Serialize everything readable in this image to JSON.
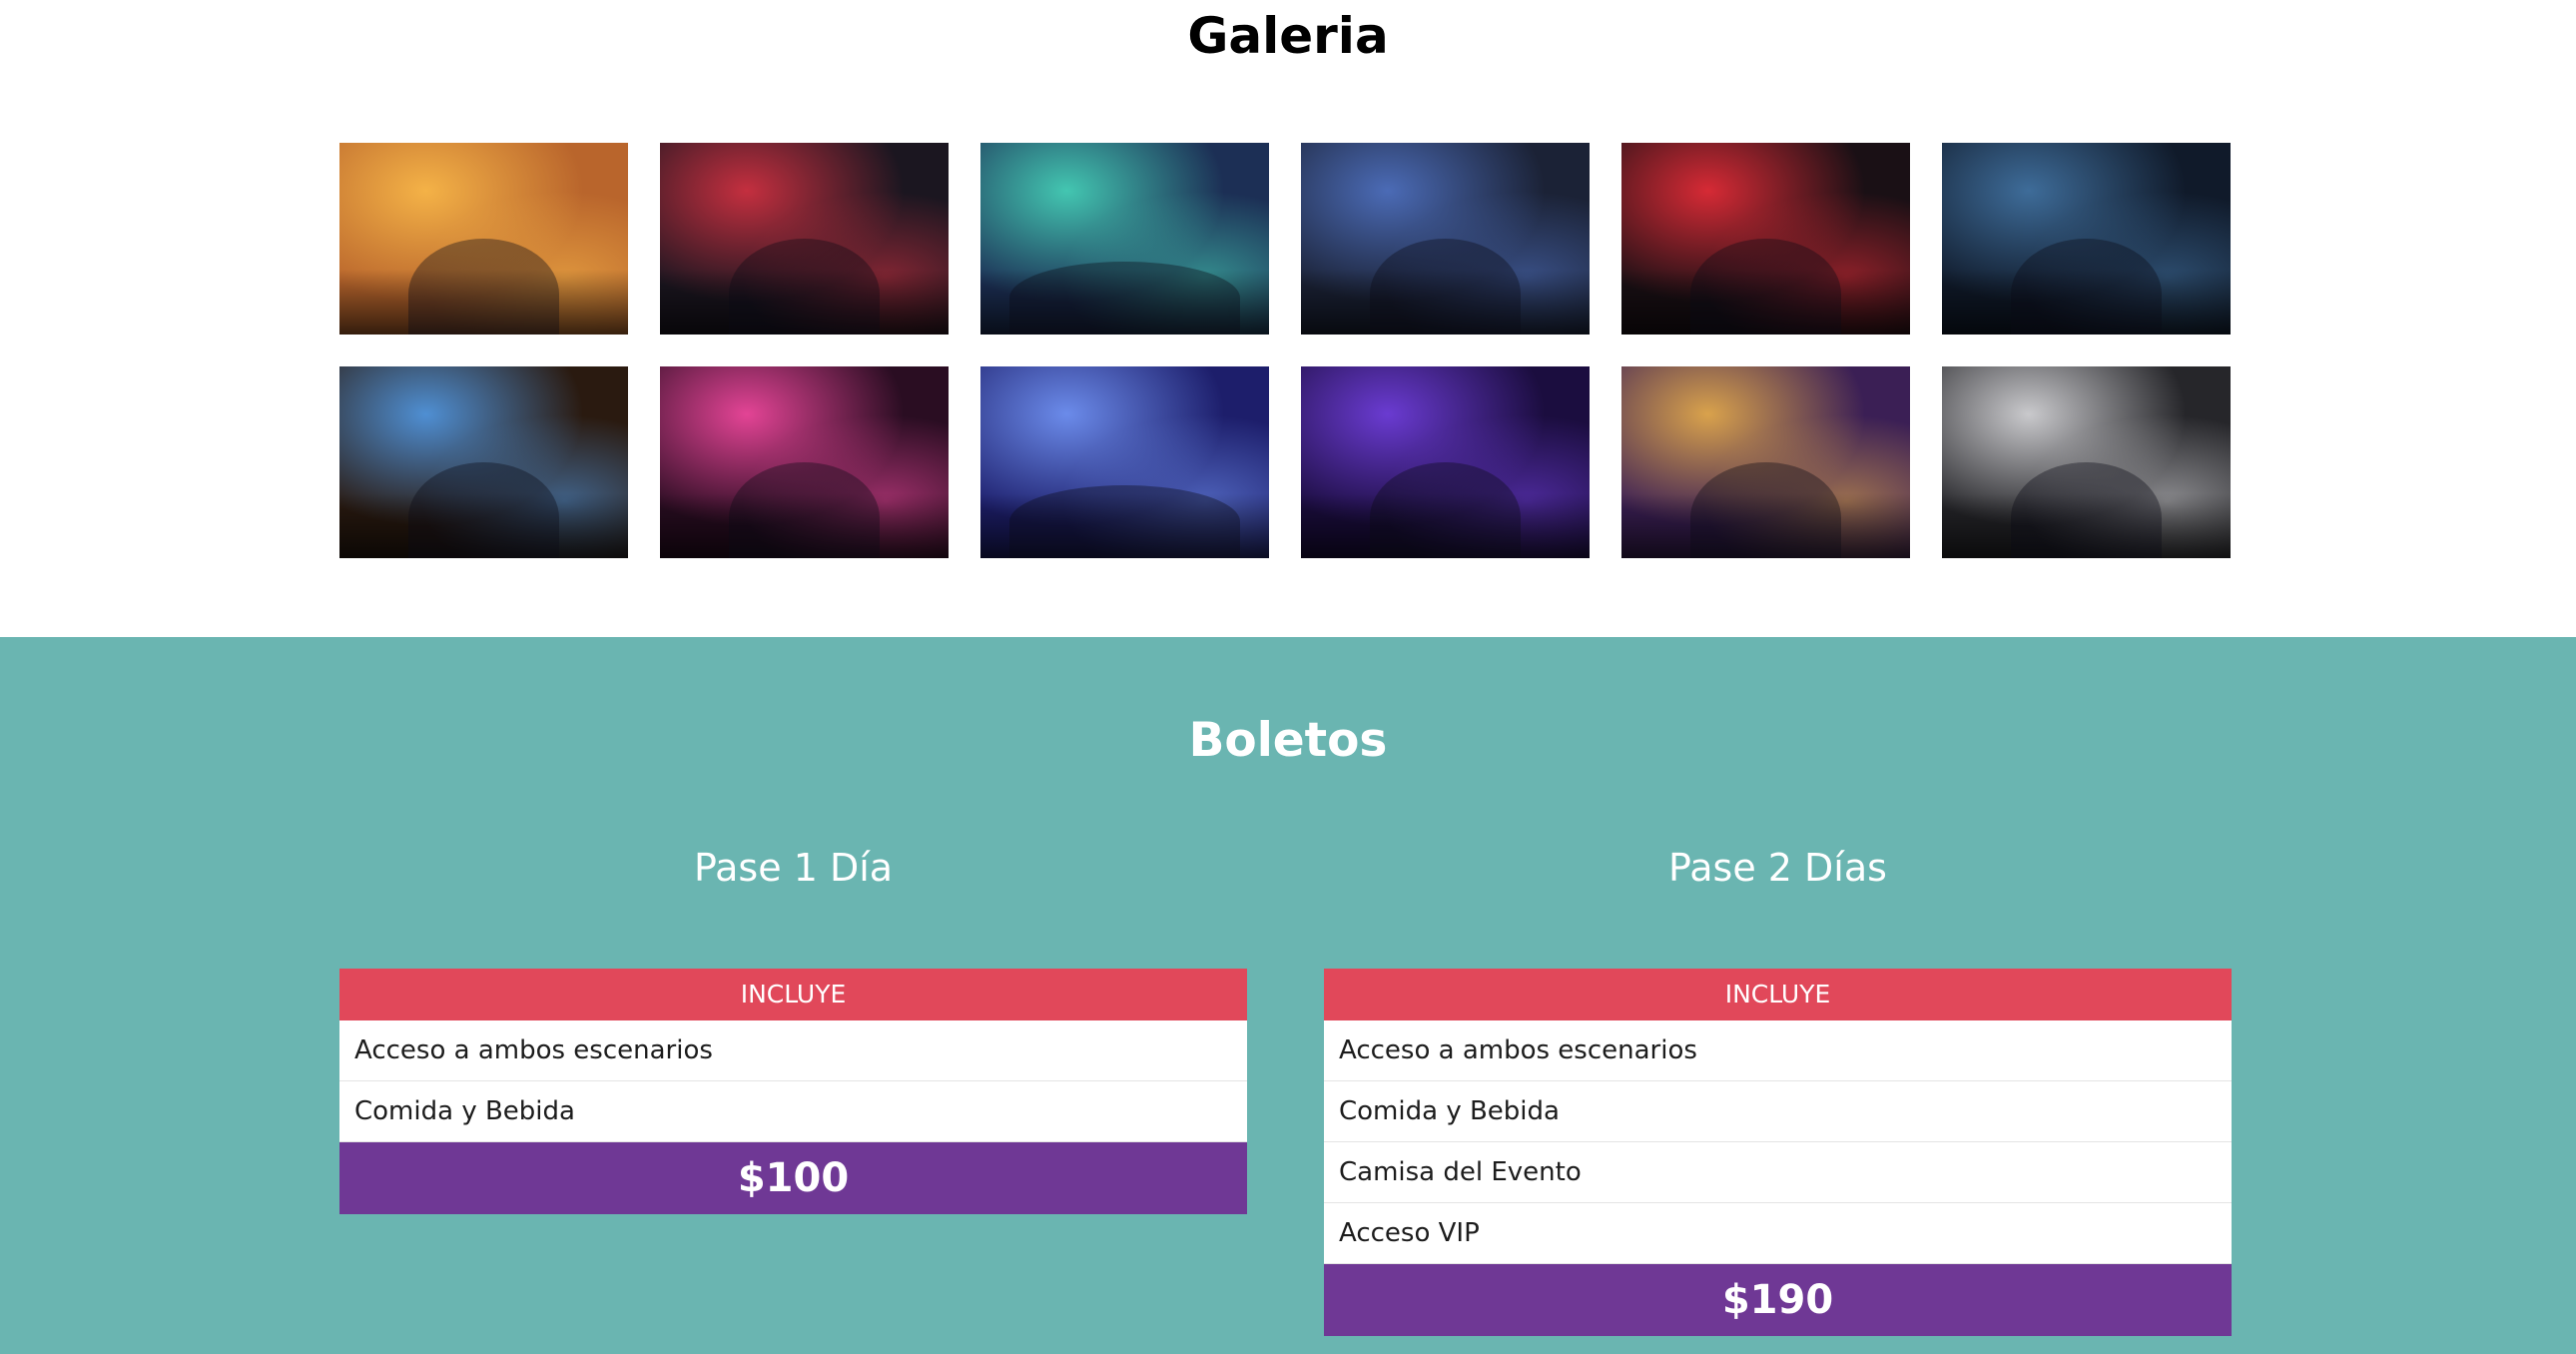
{
  "gallery": {
    "title": "Galeria",
    "photos": [
      {
        "alt": "concert-crowd-photo",
        "bg": "#b9652c",
        "accent": "#f4b247"
      },
      {
        "alt": "singer-photo",
        "bg": "#1b1620",
        "accent": "#c42f3f"
      },
      {
        "alt": "club-lights-photo",
        "bg": "#1c2f55",
        "accent": "#43c6b1"
      },
      {
        "alt": "dj-turntable-photo",
        "bg": "#1b2236",
        "accent": "#4b6bb6"
      },
      {
        "alt": "guitarist-red-photo",
        "bg": "#1a1015",
        "accent": "#d62a35"
      },
      {
        "alt": "dj-blue-stage-photo",
        "bg": "#101a2a",
        "accent": "#3e6c99"
      },
      {
        "alt": "guitar-closeup-photo",
        "bg": "#2a1a10",
        "accent": "#4f8fd3"
      },
      {
        "alt": "dj-laptop-photo",
        "bg": "#2a0d22",
        "accent": "#e34495"
      },
      {
        "alt": "dj-hand-mixer-photo",
        "bg": "#1d1e6b",
        "accent": "#6b8bea"
      },
      {
        "alt": "dj-purple-turntable-photo",
        "bg": "#1b0d3f",
        "accent": "#6a3bd1"
      },
      {
        "alt": "band-duo-photo",
        "bg": "#3b1f55",
        "accent": "#d9a24c"
      },
      {
        "alt": "smoke-performer-photo",
        "bg": "#26262a",
        "accent": "#c9c9cc"
      }
    ]
  },
  "tickets": {
    "title": "Boletos",
    "passes": [
      {
        "name": "Pase 1 Día",
        "includes_label": "INCLUYE",
        "features": [
          "Acceso a ambos escenarios",
          "Comida y Bebida"
        ],
        "price": "$100"
      },
      {
        "name": "Pase 2 Días",
        "includes_label": "INCLUYE",
        "features": [
          "Acceso a ambos escenarios",
          "Comida y Bebida",
          "Camisa del Evento",
          "Acceso VIP"
        ],
        "price": "$190"
      }
    ]
  },
  "colors": {
    "teal_background": "#6ab5b1",
    "includes_red": "#e1485a",
    "price_purple": "#6f3895"
  }
}
